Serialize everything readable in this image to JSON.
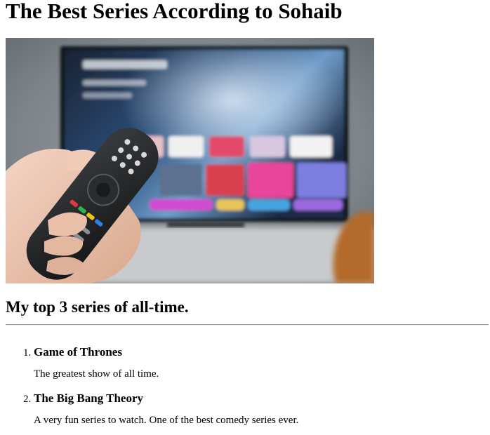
{
  "page": {
    "title": "The Best Series According to Sohaib",
    "hero_image_alt": "Hand holding TV remote in front of television",
    "subtitle": "My top 3 series of all-time."
  },
  "series_list": [
    {
      "name": "Game of Thrones",
      "description": "The greatest show of all time."
    },
    {
      "name": "The Big Bang Theory",
      "description": "A very fun series to watch. One of the best comedy series ever."
    }
  ]
}
